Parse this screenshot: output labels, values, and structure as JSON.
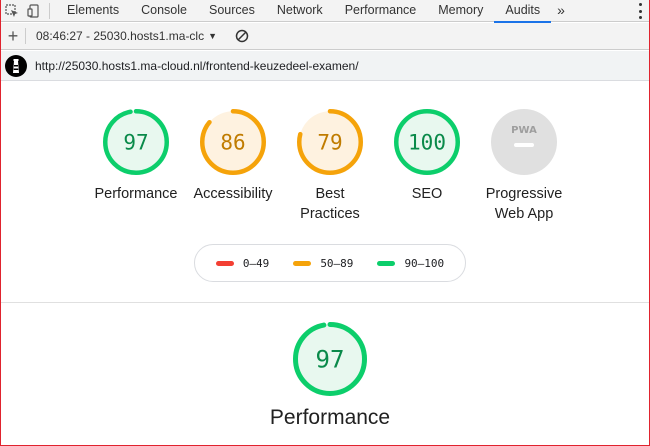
{
  "devtools": {
    "tabs": [
      {
        "label": "Elements",
        "active": false
      },
      {
        "label": "Console",
        "active": false
      },
      {
        "label": "Sources",
        "active": false
      },
      {
        "label": "Network",
        "active": false
      },
      {
        "label": "Performance",
        "active": false
      },
      {
        "label": "Memory",
        "active": false
      },
      {
        "label": "Audits",
        "active": true
      }
    ],
    "more": "»"
  },
  "toolbar": {
    "report_label": "08:46:27 - 25030.hosts1.ma-clc"
  },
  "report": {
    "url": "http://25030.hosts1.ma-cloud.nl/frontend-keuzedeel-examen/"
  },
  "gauges": [
    {
      "label": "Performance",
      "score": 97,
      "rating": "pass"
    },
    {
      "label": "Accessibility",
      "score": 86,
      "rating": "average"
    },
    {
      "label": "Best Practices",
      "score": 79,
      "rating": "average"
    },
    {
      "label": "SEO",
      "score": 100,
      "rating": "pass"
    },
    {
      "label": "Progressive Web App",
      "score": null,
      "rating": "pwa",
      "badge": "PWA"
    }
  ],
  "legend": [
    {
      "range": "0–49",
      "color": "#f33f33"
    },
    {
      "range": "50–89",
      "color": "#f5a30a"
    },
    {
      "range": "90–100",
      "color": "#0cce6b"
    }
  ],
  "category": {
    "title": "Performance",
    "score": 97,
    "rating": "pass"
  },
  "colors": {
    "pass": "#0cce6b",
    "pass_text": "#0a8a4a",
    "pass_bg": "#e8f8ef",
    "average": "#f5a30a",
    "average_text": "#c07c00",
    "average_bg": "#fef2e0",
    "fail": "#f33f33",
    "pwa_bg": "#e0e0e0",
    "accent": "#1a73e8"
  }
}
